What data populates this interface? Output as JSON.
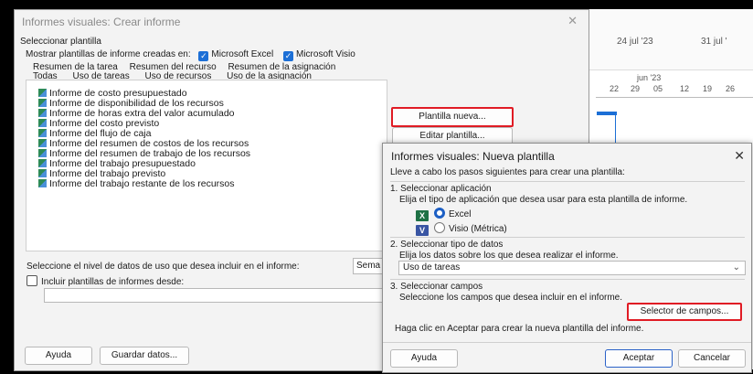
{
  "dialog_main": {
    "title": "Informes visuales: Crear informe",
    "section_label": "Seleccionar plantilla",
    "show_templates_label": "Mostrar plantillas de informe creadas en:",
    "excel_checkbox": "Microsoft Excel",
    "visio_checkbox": "Microsoft Visio",
    "tabs_row1": [
      "Resumen de la tarea",
      "Resumen del recurso",
      "Resumen de la asignación"
    ],
    "tabs_row2": [
      "Todas",
      "Uso de tareas",
      "Uso de recursos",
      "Uso de la asignación"
    ],
    "reports": [
      "Informe de costo presupuestado",
      "Informe de disponibilidad de los recursos",
      "Informe de horas extra del valor acumulado",
      "Informe del costo previsto",
      "Informe del flujo de caja",
      "Informe del resumen de costos de los recursos",
      "Informe del resumen de trabajo de los recursos",
      "Informe del trabajo presupuestado",
      "Informe del trabajo previsto",
      "Informe del trabajo restante de los recursos"
    ],
    "new_template_button": "Plantilla nueva...",
    "edit_template_button": "Editar plantilla...",
    "usage_level_label": "Seleccione el nivel de datos de uso que desea incluir en el informe:",
    "usage_level_value": "Sema",
    "include_templates_label": "Incluir plantillas de informes desde:",
    "help_button": "Ayuda",
    "save_data_button": "Guardar datos..."
  },
  "gantt": {
    "week1": "24 jul '23",
    "week2": "31 jul '",
    "month": "jun '23",
    "days": [
      "22",
      "29",
      "05",
      "12",
      "19",
      "26"
    ]
  },
  "dialog_new": {
    "title": "Informes visuales: Nueva plantilla",
    "intro": "Lleve a cabo los pasos siguientes para crear una plantilla:",
    "step1_title": "1. Seleccionar aplicación",
    "step1_desc": "Elija el tipo de aplicación que desea usar para esta plantilla de informe.",
    "app_excel": "Excel",
    "app_visio": "Visio (Métrica)",
    "step2_title": "2. Seleccionar tipo de datos",
    "step2_desc": "Elija los datos sobre los que desea realizar el informe.",
    "data_type_value": "Uso de tareas",
    "step3_title": "3. Seleccionar campos",
    "step3_desc": "Seleccione los campos que desea incluir en el informe.",
    "field_picker_button": "Selector de campos...",
    "finish_text": "Haga clic en Aceptar para crear la nueva plantilla del informe.",
    "help_button": "Ayuda",
    "accept_button": "Aceptar",
    "cancel_button": "Cancelar"
  },
  "colors": {
    "highlight": "#e01b24",
    "accent": "#1c6fd6"
  }
}
